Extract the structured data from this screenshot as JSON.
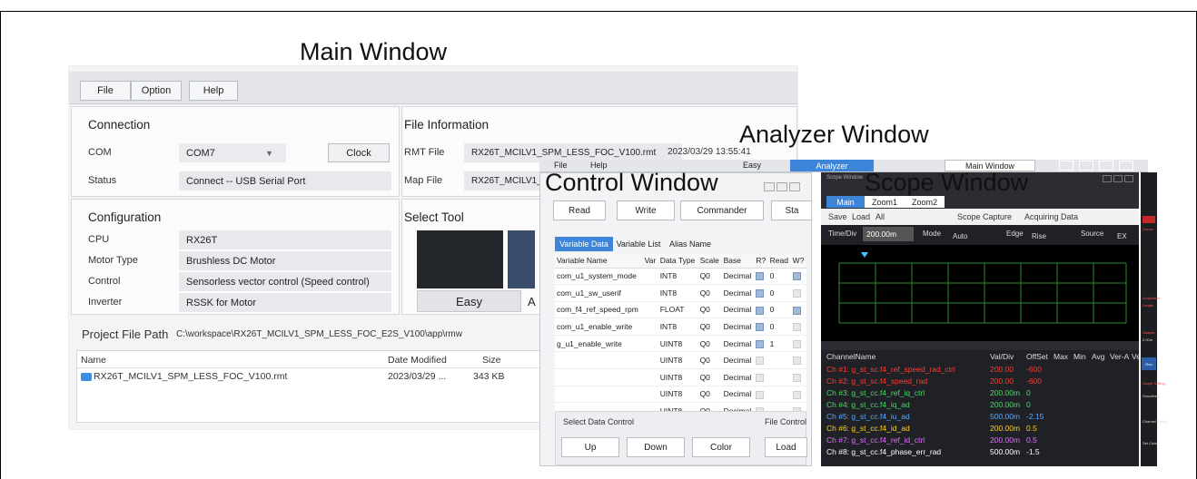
{
  "labels": {
    "main": "Main Window",
    "analyzer": "Analyzer Window",
    "control": "Control Window",
    "scope": "Scope Window"
  },
  "main": {
    "menu": [
      "File",
      "Option",
      "Help"
    ],
    "connection": {
      "title": "Connection",
      "com_label": "COM",
      "com_value": "COM7",
      "clock": "Clock",
      "status_label": "Status",
      "status_value": "Connect -- USB Serial Port"
    },
    "fileinfo": {
      "title": "File Information",
      "rmt_label": "RMT File",
      "rmt_value": "RX26T_MCILV1_SPM_LESS_FOC_V100.rmt",
      "rmt_date": "2023/03/29 13:55:41",
      "map_label": "Map File",
      "map_value": "RX26T_MCILV1_"
    },
    "config": {
      "title": "Configuration",
      "rows": [
        [
          "CPU",
          "RX26T"
        ],
        [
          "Motor Type",
          "Brushless DC Motor"
        ],
        [
          "Control",
          "Sensorless vector control (Speed control)"
        ],
        [
          "Inverter",
          "RSSK for Motor"
        ]
      ]
    },
    "tool": {
      "title": "Select Tool",
      "easy": "Easy",
      "a": "A"
    },
    "project": {
      "label": "Project File Path",
      "path": "C:\\workspace\\RX26T_MCILV1_SPM_LESS_FOC_E2S_V100\\app\\rmw"
    },
    "files": {
      "headers": [
        "Name",
        "Date Modified",
        "Size"
      ],
      "name": "RX26T_MCILV1_SPM_LESS_FOC_V100.rmt",
      "date": "2023/03/29 ...",
      "size": "343 KB"
    }
  },
  "analyzer": {
    "tabs": [
      "File",
      "Help"
    ],
    "modes": [
      "Easy",
      "Analyzer"
    ],
    "main_btn": "Main Window"
  },
  "control": {
    "tools": [
      "Read",
      "Write",
      "Commander",
      "Sta"
    ],
    "tabs": [
      "Variable Data",
      "Variable List",
      "Alias Name"
    ],
    "headers": [
      "Variable Name",
      "Var",
      "Data Type",
      "Scale",
      "Base",
      "R?",
      "Read",
      "W?"
    ],
    "rows": [
      [
        "com_u1_system_mode",
        "INT8",
        "Q0",
        "Decimal",
        "0"
      ],
      [
        "com_u1_sw_userif",
        "INT8",
        "Q0",
        "Decimal",
        "0"
      ],
      [
        "com_f4_ref_speed_rpm",
        "FLOAT",
        "Q0",
        "Decimal",
        "0"
      ],
      [
        "com_u1_enable_write",
        "INT8",
        "Q0",
        "Decimal",
        "0"
      ],
      [
        "g_u1_enable_write",
        "UINT8",
        "Q0",
        "Decimal",
        "1"
      ],
      [
        "",
        "UINT8",
        "Q0",
        "Decimal",
        ""
      ],
      [
        "",
        "UINT8",
        "Q0",
        "Decimal",
        ""
      ],
      [
        "",
        "UINT8",
        "Q0",
        "Decimal",
        ""
      ],
      [
        "",
        "UINT8",
        "Q0",
        "Decimal",
        ""
      ]
    ],
    "select_title": "Select Data Control",
    "file_title": "File Control",
    "buttons": [
      "Up",
      "Down",
      "Color",
      "Load"
    ]
  },
  "scope": {
    "title": "Scope Window",
    "tabs": [
      "Main",
      "Zoom1",
      "Zoom2"
    ],
    "save": "Save",
    "load": "Load",
    "all": "All",
    "capture": "Scope Capture",
    "acquiring": "Acquiring Data",
    "timediv": "Time/Div",
    "timeval": "200.00m",
    "mode": "Mode",
    "auto": "Auto",
    "edge": "Edge",
    "rise": "Rise",
    "source": "Source",
    "ex": "EX",
    "headers": [
      "ChannelName",
      "Val/Div",
      "OffSet",
      "Max",
      "Min",
      "Avg",
      "Ver-A",
      "Ve"
    ],
    "channels": [
      {
        "name": "Ch #1: g_st_sc.f4_ref_speed_rad_ctrl",
        "val": "200.00",
        "off": "-600",
        "color": "#ff3b2f"
      },
      {
        "name": "Ch #2: g_st_sc.f4_speed_rad",
        "val": "200.00",
        "off": "-600",
        "color": "#ff3b2f"
      },
      {
        "name": "Ch #3: g_st_cc.f4_ref_iq_ctrl",
        "val": "200.00m",
        "off": "0",
        "color": "#4cd964"
      },
      {
        "name": "Ch #4: g_st_cc.f4_iq_ad",
        "val": "200.00m",
        "off": "0",
        "color": "#4cd964"
      },
      {
        "name": "Ch #5: g_st_cc.f4_iu_ad",
        "val": "500.00m",
        "off": "-2.15",
        "color": "#5aa9ff"
      },
      {
        "name": "Ch #6: g_st_cc.f4_id_ad",
        "val": "200.00m",
        "off": "0.5",
        "color": "#ffd21f"
      },
      {
        "name": "Ch #7: g_st_cc.f4_ref_id_ctrl",
        "val": "200.00m",
        "off": "0.5",
        "color": "#e070ff"
      },
      {
        "name": "Ch #8: g_st_cc.f4_phase_err_rad",
        "val": "500.00m",
        "off": "-1.5",
        "color": "#ffffff"
      }
    ],
    "side": {
      "cursor": "Cursor",
      "acq": "Acquisition",
      "length": "Length",
      "sample": "Sample",
      "sampleval": "2.00m",
      "run": "Run",
      "graph": "Graph Setting",
      "smoothing": "Smoothing",
      "channel": "Channel Setting",
      "setcolor": "Set Color"
    }
  }
}
